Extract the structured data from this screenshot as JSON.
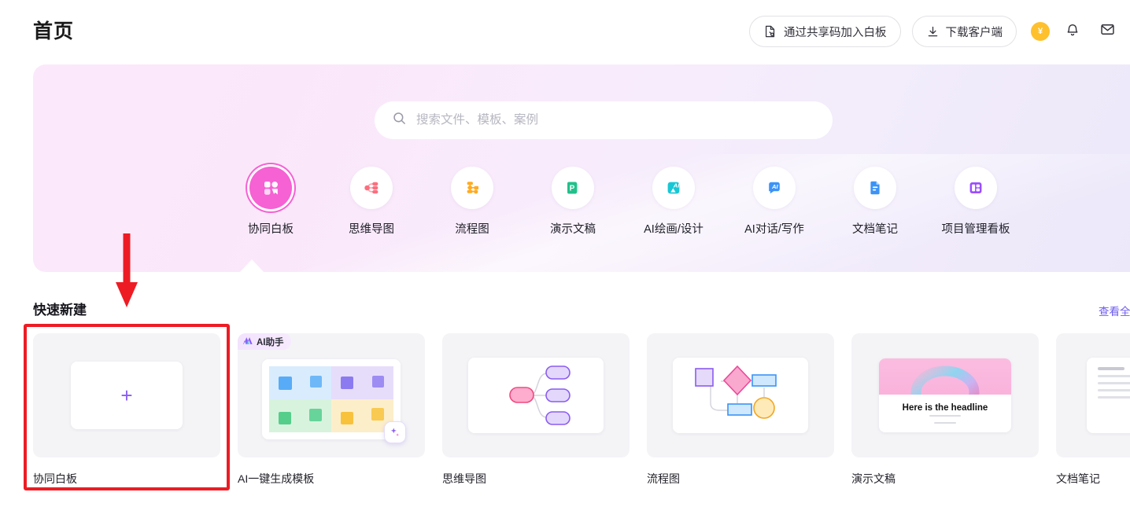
{
  "header": {
    "title": "首页",
    "join_button": {
      "label": "通过共享码加入白板",
      "icon": "share-code-icon"
    },
    "download_button": {
      "label": "下载客户端",
      "icon": "download-icon"
    },
    "coin_badge": {
      "label": "¥",
      "color": "#FFC02E"
    },
    "notification_icon": "bell-icon",
    "inbox_icon": "inbox-icon"
  },
  "banner": {
    "search": {
      "placeholder": "搜索文件、模板、案例",
      "value": "",
      "icon": "search-icon"
    },
    "quick_icons": [
      {
        "label": "协同白板",
        "icon": "whiteboard-icon",
        "active": true,
        "color": "#F661D4"
      },
      {
        "label": "思维导图",
        "icon": "mindmap-icon",
        "active": false,
        "color": "#FB6E7E"
      },
      {
        "label": "流程图",
        "icon": "flowchart-icon",
        "active": false,
        "color": "#FFAB20"
      },
      {
        "label": "演示文稿",
        "icon": "presentation-icon",
        "active": false,
        "color": "#22C08A"
      },
      {
        "label": "AI绘画/设计",
        "icon": "ai-drawing-icon",
        "active": false,
        "color": "#18C7D4"
      },
      {
        "label": "AI对话/写作",
        "icon": "ai-chat-icon",
        "active": false,
        "color": "#3B93F7"
      },
      {
        "label": "文档笔记",
        "icon": "document-icon",
        "active": false,
        "color": "#3B93F7"
      },
      {
        "label": "项目管理看板",
        "icon": "kanban-icon",
        "active": false,
        "color": "#9B4DFF"
      }
    ]
  },
  "quick_create": {
    "title": "快速新建",
    "view_all_label": "查看全",
    "cards": [
      {
        "label": "协同白板",
        "thumb": "plus-placeholder",
        "badge": null
      },
      {
        "label": "AI一键生成模板",
        "thumb": "ai-template-grid",
        "badge": "AI助手"
      },
      {
        "label": "思维导图",
        "thumb": "mindmap-preview",
        "badge": null
      },
      {
        "label": "流程图",
        "thumb": "flowchart-preview",
        "badge": null
      },
      {
        "label": "演示文稿",
        "thumb": "slide-preview",
        "badge": null,
        "slide_headline": "Here is the headline"
      },
      {
        "label": "文档笔记",
        "thumb": "document-preview",
        "badge": null
      }
    ]
  },
  "annotations": {
    "highlight_color": "#ED1C24",
    "arrow_color": "#ED1C24"
  }
}
